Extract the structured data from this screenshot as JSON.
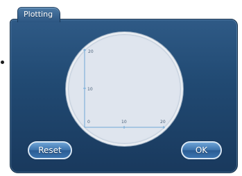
{
  "window": {
    "tab_label": "Plotting"
  },
  "plot": {
    "y_tick_top": "20",
    "y_tick_mid": "10",
    "origin_label": "0",
    "x_tick_mid": "10",
    "x_tick_right": "20"
  },
  "buttons": {
    "reset_label": "Reset",
    "ok_label": "OK"
  },
  "colors": {
    "panel": "#214a73",
    "plot_fill": "#dfe5ee",
    "axis": "#6fa8d6",
    "button": "#3d74ad"
  }
}
